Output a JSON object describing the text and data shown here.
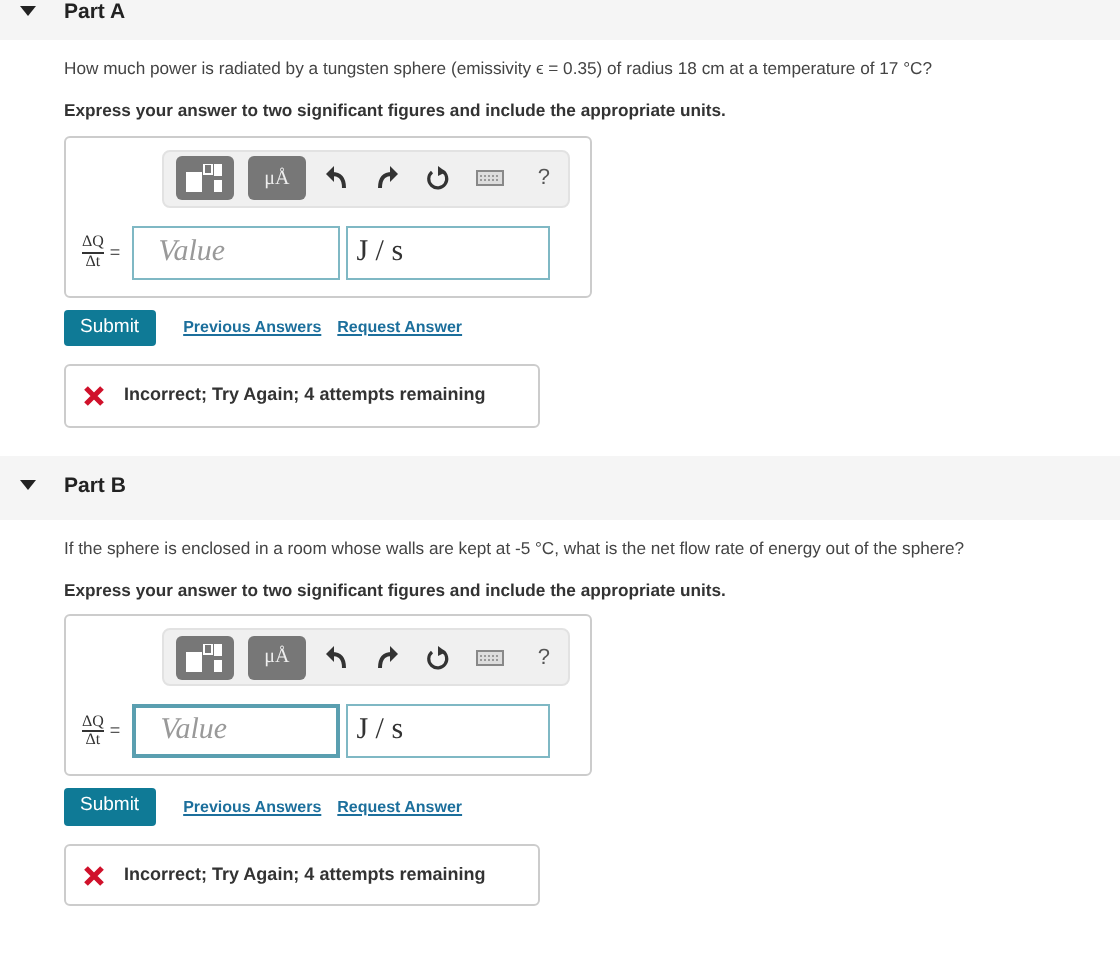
{
  "parts": [
    {
      "title": "Part A",
      "expanded": true,
      "question": "How much power is radiated by a tungsten sphere (emissivity ϵ = 0.35) of radius 18 cm at a temperature of 17 °C?",
      "instruction": "Express your answer to two significant figures and include the appropriate units.",
      "toolbar": {
        "units_label": "μÅ",
        "help": "?"
      },
      "lhs": {
        "numerator": "ΔQ",
        "denominator": "Δt",
        "equals": "="
      },
      "value": {
        "placeholder": "Value",
        "focused": false
      },
      "units": {
        "value": "J / s"
      },
      "submit": "Submit",
      "links": [
        "Previous Answers",
        "Request Answer"
      ],
      "feedback": {
        "text": "Incorrect; Try Again; 4 attempts remaining"
      }
    },
    {
      "title": "Part B",
      "expanded": true,
      "question": "If the sphere is enclosed in a room whose walls are kept at -5 °C, what is the net flow rate of energy out of the sphere?",
      "instruction": "Express your answer to two significant figures and include the appropriate units.",
      "toolbar": {
        "units_label": "μÅ",
        "help": "?"
      },
      "lhs": {
        "numerator": "ΔQ",
        "denominator": "Δt",
        "equals": "="
      },
      "value": {
        "placeholder": "Value",
        "focused": true
      },
      "units": {
        "value": "J / s"
      },
      "submit": "Submit",
      "links": [
        "Previous Answers",
        "Request Answer"
      ],
      "feedback": {
        "text": "Incorrect; Try Again; 4 attempts remaining"
      }
    }
  ]
}
